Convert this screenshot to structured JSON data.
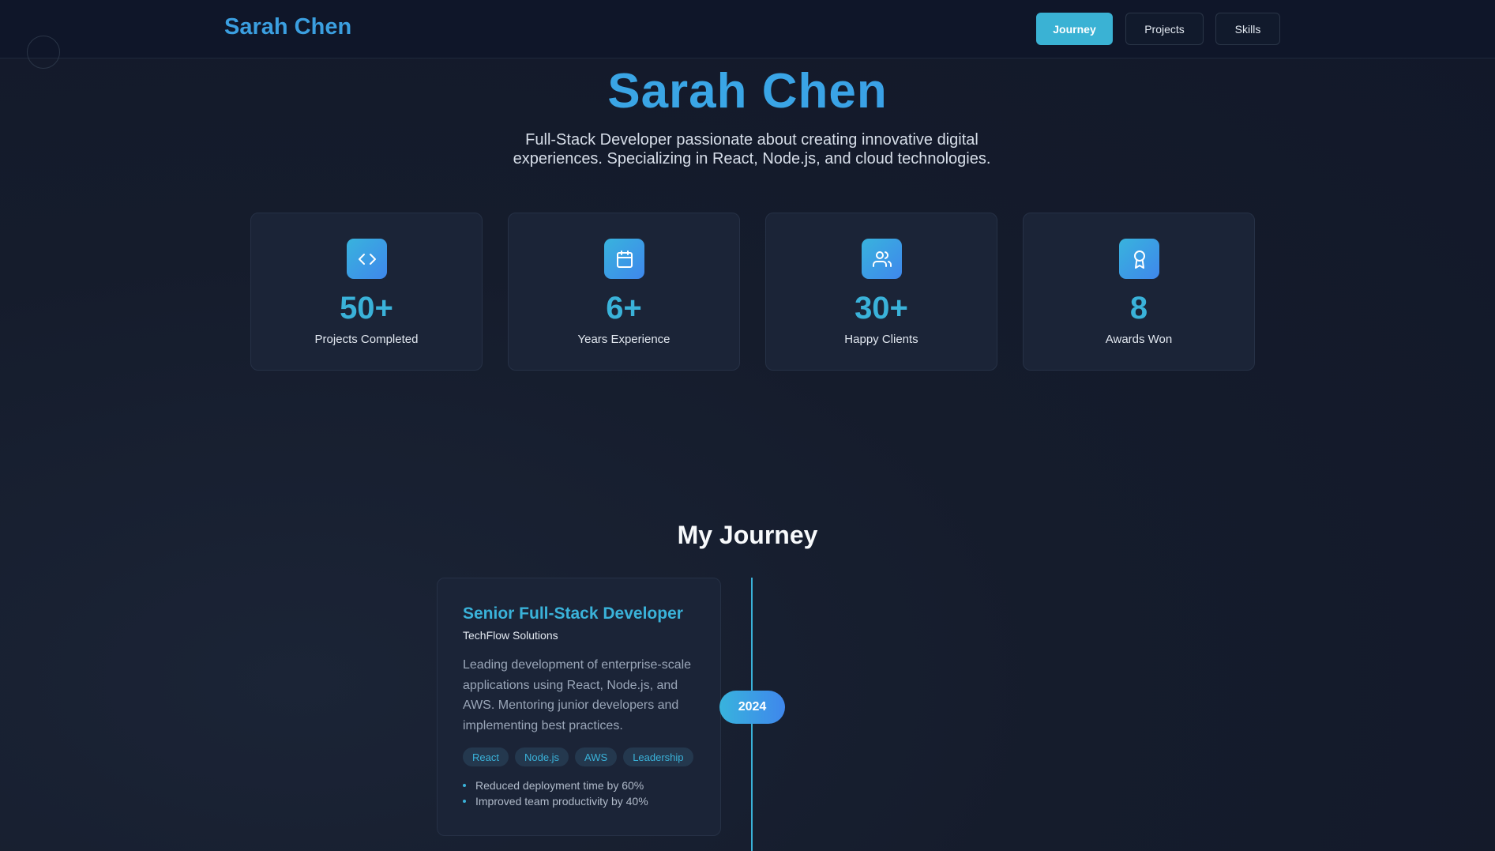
{
  "nav": {
    "brand": "Sarah Chen",
    "buttons": [
      {
        "label": "Journey",
        "active": true
      },
      {
        "label": "Projects",
        "active": false
      },
      {
        "label": "Skills",
        "active": false
      }
    ]
  },
  "hero": {
    "title": "Sarah Chen",
    "subtitle": "Full-Stack Developer passionate about creating innovative digital experiences. Specializing in React, Node.js, and cloud technologies."
  },
  "stats": [
    {
      "icon": "code-icon",
      "value": "50+",
      "label": "Projects Completed"
    },
    {
      "icon": "calendar-icon",
      "value": "6+",
      "label": "Years Experience"
    },
    {
      "icon": "users-icon",
      "value": "30+",
      "label": "Happy Clients"
    },
    {
      "icon": "award-icon",
      "value": "8",
      "label": "Awards Won"
    }
  ],
  "journey": {
    "title": "My Journey",
    "entries": [
      {
        "year": "2024",
        "role": "Senior Full-Stack Developer",
        "company": "TechFlow Solutions",
        "description": "Leading development of enterprise-scale applications using React, Node.js, and AWS. Mentoring junior developers and implementing best practices.",
        "tags": [
          "React",
          "Node.js",
          "AWS",
          "Leadership"
        ],
        "achievements": [
          "Reduced deployment time by 60%",
          "Improved team productivity by 40%"
        ]
      }
    ]
  },
  "colors": {
    "accent": "#3ab2d9",
    "brand": "#3b9fe0",
    "background": "#141b2b",
    "card": "#1b2437"
  }
}
